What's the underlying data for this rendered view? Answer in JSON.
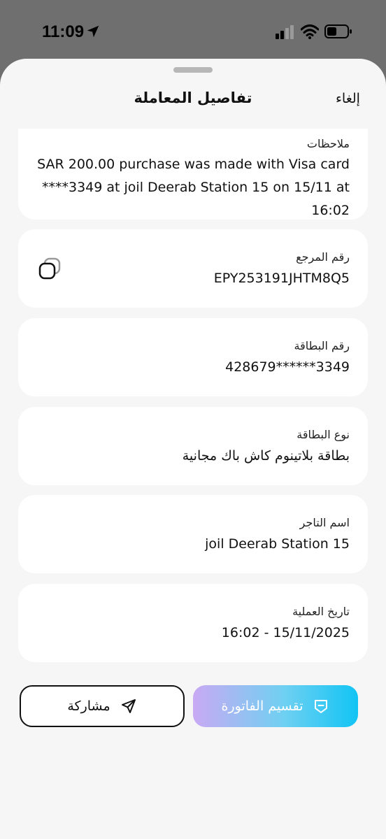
{
  "status_bar": {
    "time": "11:09"
  },
  "header": {
    "title": "تفاصيل المعاملة",
    "cancel_label": "إلغاء"
  },
  "notes": {
    "label": "ملاحظات",
    "line1": "SAR 200.00 purchase was made with Visa card",
    "line2": "****3349 at joil Deerab Station 15 on 15/11 at 16:02"
  },
  "reference": {
    "label": "رقم المرجع",
    "value": "EPY253191JHTM8Q5"
  },
  "card_number": {
    "label": "رقم البطاقة",
    "value": "428679******3349"
  },
  "card_type": {
    "label": "نوع البطاقة",
    "value": "بطاقة بلاتينوم كاش باك مجانية"
  },
  "merchant": {
    "label": "اسم التاجر",
    "value": "joil Deerab Station 15"
  },
  "date": {
    "label": "تاريخ العملية",
    "value": "16:02 - 15/11/2025"
  },
  "actions": {
    "share_label": "مشاركة",
    "split_label": "تقسيم الفاتورة"
  },
  "colors": {
    "sheet_bg": "#f6f6f6",
    "card_bg": "#ffffff",
    "split_gradient_start": "#c9a9f3",
    "split_gradient_end": "#12c4f4"
  },
  "icons": [
    "location-arrow-icon",
    "cellular-signal-icon",
    "wifi-icon",
    "battery-icon",
    "copy-icon",
    "send-icon",
    "receipt-icon"
  ]
}
